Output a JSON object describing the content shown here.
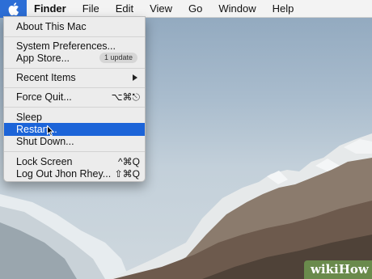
{
  "menubar": {
    "items": [
      "Finder",
      "File",
      "Edit",
      "View",
      "Go",
      "Window",
      "Help"
    ]
  },
  "apple_menu": {
    "about": "About This Mac",
    "system_preferences": "System Preferences...",
    "app_store": "App Store...",
    "app_store_badge": "1 update",
    "recent_items": "Recent Items",
    "force_quit": "Force Quit...",
    "force_quit_shortcut": "⌥⌘⎋",
    "sleep": "Sleep",
    "restart": "Restart...",
    "shut_down": "Shut Down...",
    "lock_screen": "Lock Screen",
    "lock_screen_shortcut": "^⌘Q",
    "log_out": "Log Out Jhon Rhey...",
    "log_out_shortcut": "⇧⌘Q",
    "selected_item": "Restart..."
  },
  "watermark": "wikiHow",
  "colors": {
    "menu_highlight": "#1c64d8",
    "apple_menu_active": "#2c6ed6"
  },
  "icons": [
    "apple-icon",
    "submenu-arrow-icon",
    "mouse-pointer-icon"
  ]
}
